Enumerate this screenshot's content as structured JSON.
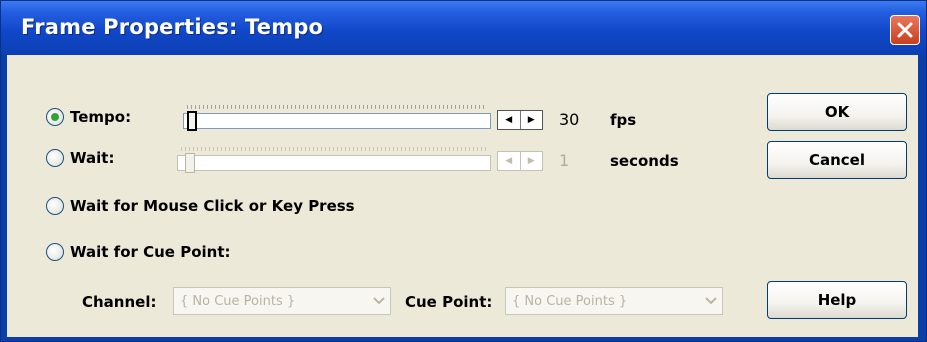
{
  "window": {
    "title": "Frame Properties: Tempo"
  },
  "options": {
    "tempo": {
      "label": "Tempo:",
      "value": "30",
      "unit": "fps",
      "selected": true
    },
    "wait": {
      "label": "Wait:",
      "value": "1",
      "unit": "seconds",
      "selected": false
    },
    "wait_mouse": {
      "label": "Wait for Mouse Click or Key Press",
      "selected": false
    },
    "wait_cue": {
      "label": "Wait for Cue Point:",
      "selected": false
    }
  },
  "cue": {
    "channel_label": "Channel:",
    "channel_value": "{ No Cue Points }",
    "cuepoint_label": "Cue Point:",
    "cuepoint_value": "{ No Cue Points }"
  },
  "buttons": {
    "ok": "OK",
    "cancel": "Cancel",
    "help": "Help"
  },
  "colors": {
    "title_bar": "#1148c9",
    "client_bg": "#ece9d8",
    "radio_dot": "#33a23a",
    "close": "#d9552f"
  },
  "icons": {
    "close": "close-icon",
    "stepper_left": "arrow-left-icon",
    "stepper_right": "arrow-right-icon",
    "dropdown": "chevron-down-icon"
  }
}
